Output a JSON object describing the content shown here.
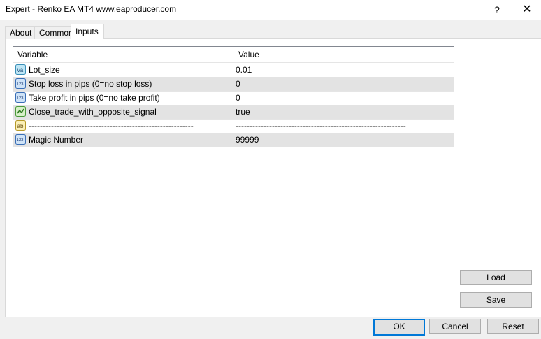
{
  "window": {
    "title": "Expert - Renko EA MT4 www.eaproducer.com",
    "help_glyph": "?",
    "close_glyph": "✕"
  },
  "tabs": [
    {
      "label": "About"
    },
    {
      "label": "Common"
    },
    {
      "label": "Inputs",
      "active": true
    }
  ],
  "grid": {
    "columns": [
      "Variable",
      "Value"
    ],
    "rows": [
      {
        "icon": "val-icon",
        "name": "Lot_size",
        "value": "0.01"
      },
      {
        "icon": "int-icon",
        "name": "Stop loss in pips (0=no stop loss)",
        "value": "0"
      },
      {
        "icon": "int-icon",
        "name": "Take profit in pips (0=no take profit)",
        "value": "0"
      },
      {
        "icon": "bool-icon",
        "name": "Close_trade_with_opposite_signal",
        "value": "true"
      },
      {
        "icon": "string-icon",
        "name": "-----------------------------------------------------------",
        "value": "-------------------------------------------------------------"
      },
      {
        "icon": "int-icon",
        "name": "Magic Number",
        "value": "99999"
      }
    ]
  },
  "buttons": {
    "load": "Load",
    "save": "Save",
    "ok": "OK",
    "cancel": "Cancel",
    "reset": "Reset"
  },
  "colors": {
    "accent": "#0078d7",
    "row_shade": "#e3e3e3"
  }
}
